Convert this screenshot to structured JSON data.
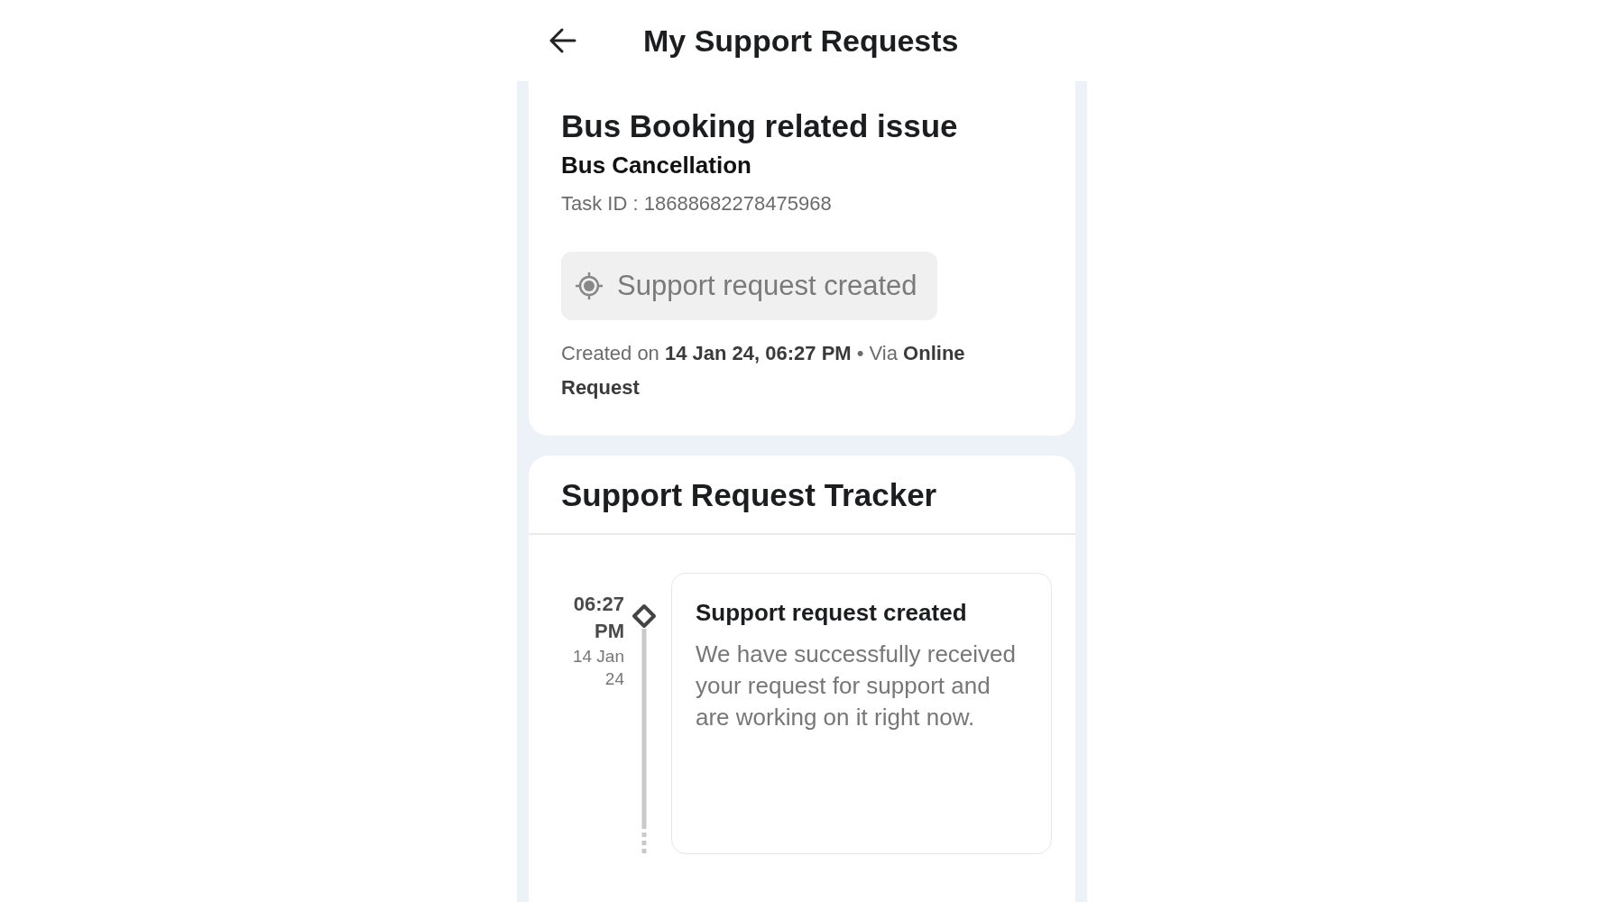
{
  "header": {
    "title": "My Support Requests"
  },
  "request": {
    "category": "Bus Booking related issue",
    "subcategory": "Bus Cancellation",
    "task_id": "Task ID : 18688682278475968",
    "status": {
      "label": "Support request created"
    },
    "created": "Created on **14 Jan 24, 06:27 PM** • Via **Online Request**"
  },
  "tracker": {
    "title": "Support Request Tracker",
    "events": [
      {
        "time": "06:27 PM",
        "date": "14 Jan 24",
        "title": "Support request created",
        "description": "We have successfully received your request for support and are working on it right now."
      }
    ]
  }
}
